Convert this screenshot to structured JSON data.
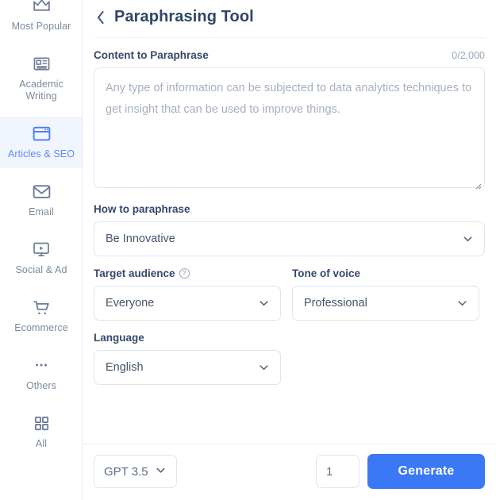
{
  "sidebar": {
    "items": [
      {
        "label": "Most Popular",
        "icon": "crown-icon",
        "active": false
      },
      {
        "label": "Academic Writing",
        "icon": "article-icon",
        "active": false
      },
      {
        "label": "Articles & SEO",
        "icon": "browser-window-icon",
        "active": true
      },
      {
        "label": "Email",
        "icon": "envelope-icon",
        "active": false
      },
      {
        "label": "Social & Ad",
        "icon": "monitor-play-icon",
        "active": false
      },
      {
        "label": "Ecommerce",
        "icon": "shopping-cart-icon",
        "active": false
      },
      {
        "label": "Others",
        "icon": "ellipsis-icon",
        "active": false
      },
      {
        "label": "All",
        "icon": "grid-icon",
        "active": false
      }
    ]
  },
  "header": {
    "back_icon": "chevron-left-icon",
    "title": "Paraphrasing Tool"
  },
  "content_field": {
    "label": "Content to Paraphrase",
    "char_count": "0/2,000",
    "placeholder": "Any type of information can be subjected to data analytics techniques to get insight that can be used to improve things.",
    "value": ""
  },
  "how_to_paraphrase": {
    "label": "How to paraphrase",
    "value": "Be Innovative",
    "chevron_icon": "chevron-down-icon"
  },
  "target_audience": {
    "label": "Target audience",
    "help_icon": "question-circle-icon",
    "help_glyph": "?",
    "value": "Everyone",
    "chevron_icon": "chevron-down-icon"
  },
  "tone_of_voice": {
    "label": "Tone of voice",
    "value": "Professional",
    "chevron_icon": "chevron-down-icon"
  },
  "language": {
    "label": "Language",
    "value": "English",
    "chevron_icon": "chevron-down-icon"
  },
  "footer": {
    "model": "GPT 3.5",
    "model_chevron_icon": "chevron-down-icon",
    "quantity": "1",
    "generate_label": "Generate"
  },
  "colors": {
    "accent": "#3b78f6",
    "active_nav_bg": "#f1f5fe",
    "active_nav_text": "#5f88f5",
    "label_text": "#33496b",
    "muted_text": "#7b8aa3",
    "border": "#dce5f2"
  }
}
